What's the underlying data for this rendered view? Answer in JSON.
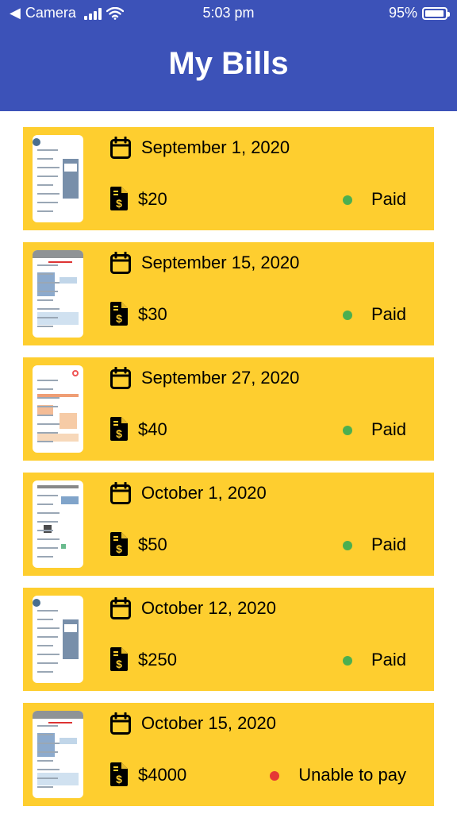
{
  "statusbar": {
    "back_label": "Camera",
    "time": "5:03 pm",
    "battery": "95%"
  },
  "header": {
    "title": "My Bills"
  },
  "colors": {
    "header": "#3c52b8",
    "card": "#fece2f",
    "paid": "#4caf50",
    "unpaid": "#e53935"
  },
  "bills": [
    {
      "date": "September 1, 2020",
      "amount": "$20",
      "status": "Paid",
      "status_color": "#4caf50",
      "thumb": "water"
    },
    {
      "date": "September 15, 2020",
      "amount": "$30",
      "status": "Paid",
      "status_color": "#4caf50",
      "thumb": "sample"
    },
    {
      "date": "September 27, 2020",
      "amount": "$40",
      "status": "Paid",
      "status_color": "#4caf50",
      "thumb": "energy"
    },
    {
      "date": "October 1, 2020",
      "amount": "$50",
      "status": "Paid",
      "status_color": "#4caf50",
      "thumb": "utility"
    },
    {
      "date": "October 12, 2020",
      "amount": "$250",
      "status": "Paid",
      "status_color": "#4caf50",
      "thumb": "water"
    },
    {
      "date": "October 15, 2020",
      "amount": "$4000",
      "status": "Unable to pay",
      "status_color": "#e53935",
      "thumb": "sample"
    }
  ]
}
